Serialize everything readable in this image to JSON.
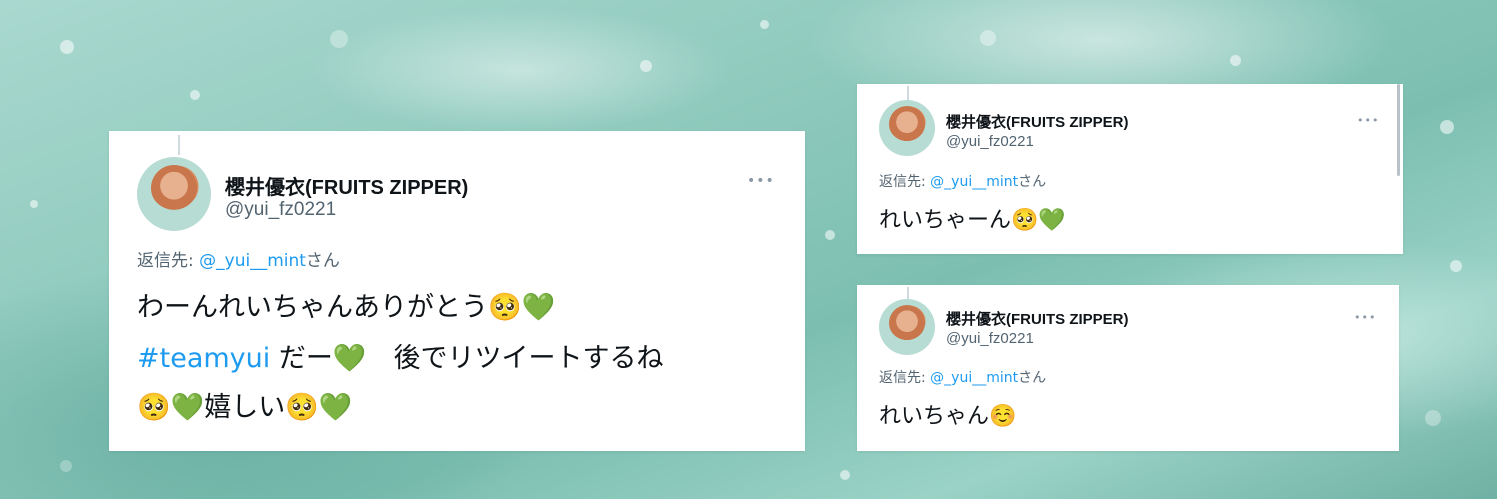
{
  "tweets": [
    {
      "name": "櫻井優衣(FRUITS ZIPPER)",
      "handle": "@yui_fz0221",
      "more": "•••",
      "reply_prefix": "返信先: ",
      "reply_mention": "@_yui__mint",
      "reply_suffix": "さん",
      "lines": [
        {
          "text": "わーんれいちゃんありがとう🥺💚"
        },
        {
          "hashtag": "#teamyui",
          "text": " だー💚　後でリツイートするね"
        },
        {
          "text": "🥺💚嬉しい🥺💚"
        }
      ]
    },
    {
      "name": "櫻井優衣(FRUITS ZIPPER)",
      "handle": "@yui_fz0221",
      "more": "•••",
      "reply_prefix": "返信先: ",
      "reply_mention": "@_yui__mint",
      "reply_suffix": "さん",
      "lines": [
        {
          "text": "れいちゃーん🥺💚"
        }
      ]
    },
    {
      "name": "櫻井優衣(FRUITS ZIPPER)",
      "handle": "@yui_fz0221",
      "more": "•••",
      "reply_prefix": "返信先: ",
      "reply_mention": "@_yui__mint",
      "reply_suffix": "さん",
      "lines": [
        {
          "text": "れいちゃん☺️"
        }
      ]
    }
  ],
  "colors": {
    "accent": "#1d9bf0",
    "text": "#0f1419",
    "secondary": "#536471",
    "background": "#8fcabd"
  }
}
